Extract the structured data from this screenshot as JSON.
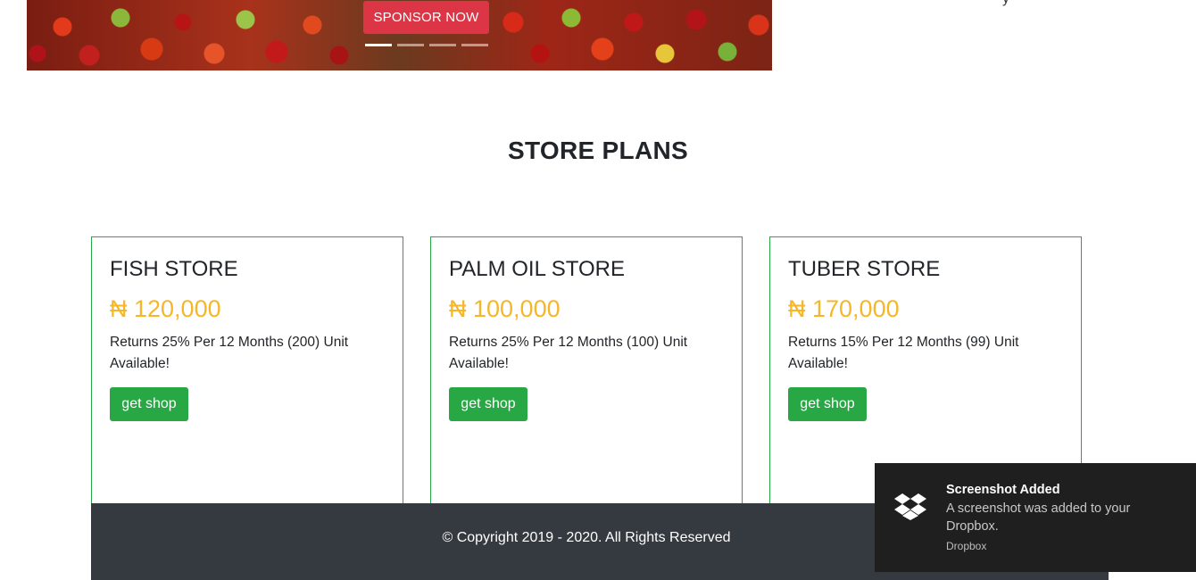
{
  "hero": {
    "sponsor_label": "SPONSOR NOW",
    "slides_count": 4,
    "active_slide": 1
  },
  "top_right_fragment": "y",
  "section": {
    "title": "STORE PLANS"
  },
  "plans": [
    {
      "name": "FISH STORE",
      "price": "₦ 120,000",
      "description": "Returns 25% Per 12 Months (200) Unit Available!",
      "button": "get shop"
    },
    {
      "name": "PALM OIL STORE",
      "price": "₦ 100,000",
      "description": "Returns 25% Per 12 Months (100) Unit Available!",
      "button": "get shop"
    },
    {
      "name": "TUBER STORE",
      "price": "₦ 170,000",
      "description": "Returns 15% Per 12 Months (99) Unit Available!",
      "button": "get shop"
    }
  ],
  "footer": {
    "copyright": "© Copyright 2019 - 2020. All Rights Reserved"
  },
  "toast": {
    "icon": "dropbox-icon",
    "title": "Screenshot Added",
    "body": "A screenshot was added to your Dropbox.",
    "source": "Dropbox"
  },
  "colors": {
    "primary_red": "#dc3545",
    "success_green": "#28a745",
    "price_gold": "#f5b728",
    "footer_bg": "#343a40",
    "toast_bg": "#1f1f1f"
  }
}
